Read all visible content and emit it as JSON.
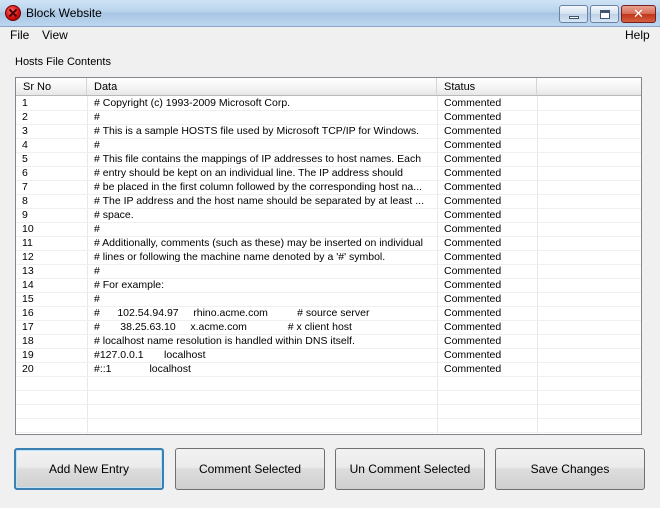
{
  "window": {
    "title": "Block Website"
  },
  "menu": {
    "file": "File",
    "view": "View",
    "help": "Help"
  },
  "group_label": "Hosts File Contents",
  "table": {
    "columns": [
      "Sr No",
      "Data",
      "Status",
      ""
    ],
    "rows": [
      {
        "sr": "1",
        "data": "# Copyright (c) 1993-2009 Microsoft Corp.",
        "status": "Commented"
      },
      {
        "sr": "2",
        "data": "#",
        "status": "Commented"
      },
      {
        "sr": "3",
        "data": "# This is a sample HOSTS file used by Microsoft TCP/IP for Windows.",
        "status": "Commented"
      },
      {
        "sr": "4",
        "data": "#",
        "status": "Commented"
      },
      {
        "sr": "5",
        "data": "# This file contains the mappings of IP addresses to host names. Each",
        "status": "Commented"
      },
      {
        "sr": "6",
        "data": "# entry should be kept on an individual line. The IP address should",
        "status": "Commented"
      },
      {
        "sr": "7",
        "data": "# be placed in the first column followed by the corresponding host na...",
        "status": "Commented"
      },
      {
        "sr": "8",
        "data": "# The IP address and the host name should be separated by at least ...",
        "status": "Commented"
      },
      {
        "sr": "9",
        "data": "# space.",
        "status": "Commented"
      },
      {
        "sr": "10",
        "data": "#",
        "status": "Commented"
      },
      {
        "sr": "11",
        "data": "# Additionally, comments (such as these) may be inserted on individual",
        "status": "Commented"
      },
      {
        "sr": "12",
        "data": "# lines or following the machine name denoted by a '#' symbol.",
        "status": "Commented"
      },
      {
        "sr": "13",
        "data": "#",
        "status": "Commented"
      },
      {
        "sr": "14",
        "data": "# For example:",
        "status": "Commented"
      },
      {
        "sr": "15",
        "data": "#",
        "status": "Commented"
      },
      {
        "sr": "16",
        "data": "#      102.54.94.97     rhino.acme.com          # source server",
        "status": "Commented"
      },
      {
        "sr": "17",
        "data": "#       38.25.63.10     x.acme.com              # x client host",
        "status": "Commented"
      },
      {
        "sr": "18",
        "data": "# localhost name resolution is handled within DNS itself.",
        "status": "Commented"
      },
      {
        "sr": "19",
        "data": "#127.0.0.1       localhost",
        "status": "Commented"
      },
      {
        "sr": "20",
        "data": "#::1             localhost",
        "status": "Commented"
      },
      {
        "sr": "",
        "data": "",
        "status": ""
      },
      {
        "sr": "",
        "data": "",
        "status": ""
      },
      {
        "sr": "",
        "data": "",
        "status": ""
      },
      {
        "sr": "",
        "data": "",
        "status": ""
      }
    ]
  },
  "buttons": {
    "add": "Add New Entry",
    "comment": "Comment Selected",
    "uncomment": "Un Comment Selected",
    "save": "Save Changes"
  },
  "icons": {
    "app": "block-icon",
    "minimize": "minimize-icon",
    "maximize": "maximize-icon",
    "close": "close-icon"
  }
}
